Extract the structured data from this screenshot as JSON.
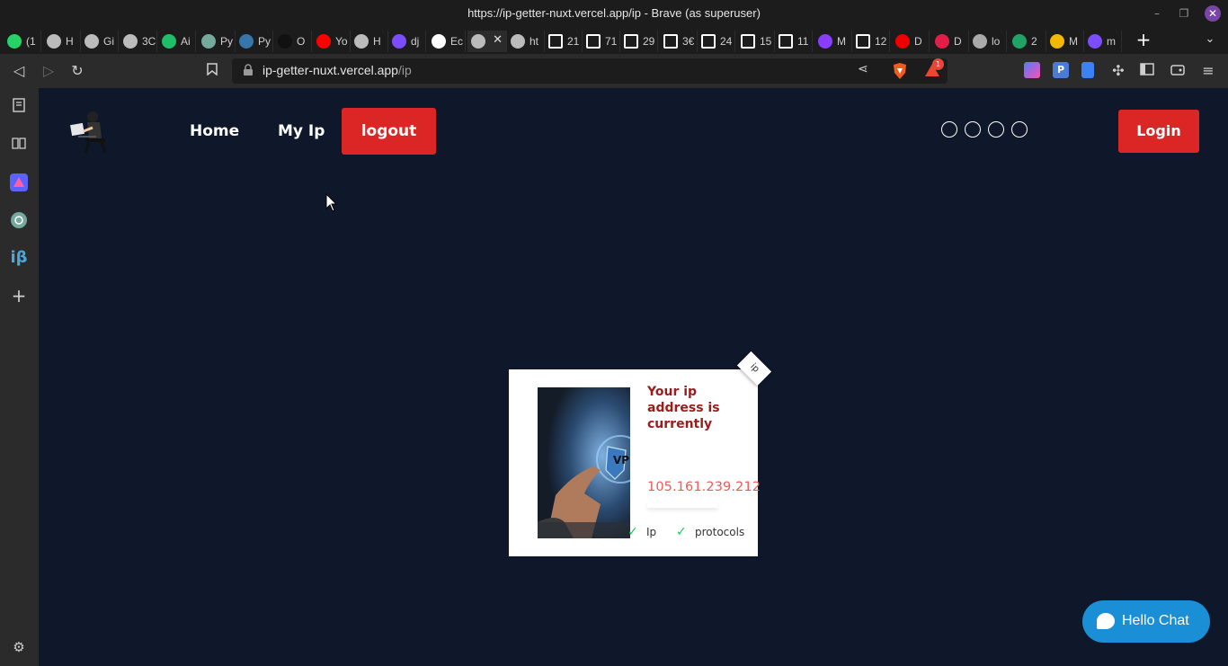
{
  "window": {
    "title": "https://ip-getter-nuxt.vercel.app/ip - Brave (as superuser)",
    "minimize_icon": "minimize-icon",
    "restore_icon": "restore-icon",
    "close_icon": "close-icon"
  },
  "tabs": [
    {
      "label": "(1",
      "icon": "whatsapp-icon",
      "color": "#25d366"
    },
    {
      "label": "H",
      "icon": "globe-icon",
      "color": "#bbbbbb"
    },
    {
      "label": "Gi",
      "icon": "globe-icon",
      "color": "#bbbbbb"
    },
    {
      "label": "3C",
      "icon": "globe-icon",
      "color": "#bbbbbb"
    },
    {
      "label": "Ai",
      "icon": "activity-icon",
      "color": "#1fbf6a"
    },
    {
      "label": "Py",
      "icon": "openai-icon",
      "color": "#74aa9c"
    },
    {
      "label": "Py",
      "icon": "python-icon",
      "color": "#3776ab"
    },
    {
      "label": "O",
      "icon": "openai-dark-icon",
      "color": "#111111"
    },
    {
      "label": "Yo",
      "icon": "youtube-icon",
      "color": "#ff0000"
    },
    {
      "label": "H",
      "icon": "globe-icon",
      "color": "#bbbbbb"
    },
    {
      "label": "dj",
      "icon": "app-icon",
      "color": "#7c4dff"
    },
    {
      "label": "Ec",
      "icon": "github-icon",
      "color": "#ffffff"
    },
    {
      "label": "",
      "icon": "globe-icon",
      "color": "#bbbbbb",
      "active": true
    },
    {
      "label": "ht",
      "icon": "globe-icon",
      "color": "#bbbbbb"
    },
    {
      "label": "21",
      "icon": "f-icon",
      "color": "#ffffff"
    },
    {
      "label": "71",
      "icon": "f-icon",
      "color": "#ffffff"
    },
    {
      "label": "29",
      "icon": "f-icon",
      "color": "#ffffff"
    },
    {
      "label": "3€",
      "icon": "f-icon",
      "color": "#ffffff"
    },
    {
      "label": "24",
      "icon": "f-icon",
      "color": "#ffffff"
    },
    {
      "label": "15",
      "icon": "f-icon",
      "color": "#ffffff"
    },
    {
      "label": "11",
      "icon": "f-icon",
      "color": "#ffffff"
    },
    {
      "label": "M",
      "icon": "app-purple-icon",
      "color": "#8b3dff"
    },
    {
      "label": "12",
      "icon": "f-icon",
      "color": "#ffffff"
    },
    {
      "label": "D",
      "icon": "redhat-icon",
      "color": "#ee0000"
    },
    {
      "label": "D",
      "icon": "red-icon",
      "color": "#e11d48"
    },
    {
      "label": "lo",
      "icon": "triangle-icon",
      "color": "#aaaaaa"
    },
    {
      "label": "2",
      "icon": "px-icon",
      "color": "#21a366"
    },
    {
      "label": "M",
      "icon": "sun-icon",
      "color": "#f5b800"
    },
    {
      "label": "m",
      "icon": "app-icon",
      "color": "#7c4dff"
    }
  ],
  "toolbar": {
    "back_icon": "back-icon",
    "forward_icon": "forward-icon",
    "reload_icon": "reload-icon",
    "bookmark_icon": "bookmark-icon",
    "url_host": "ip-getter-nuxt.vercel.app",
    "url_path": "/ip",
    "rewards_badge": "1"
  },
  "page": {
    "nav": {
      "home": "Home",
      "my_ip": "My Ip",
      "logout": "logout",
      "login": "Login"
    },
    "card": {
      "heading": "Your ip address is currently",
      "ip": "105.161.239.212",
      "tag": "ip",
      "features": [
        "Ip",
        "protocols"
      ],
      "photo_text": "VP"
    },
    "chat": {
      "label": "Hello Chat"
    }
  },
  "colors": {
    "page_bg": "#0f172a",
    "accent_red": "#dc2626",
    "ip_text": "#ef5a5a",
    "heading_text": "#9b1c1c",
    "chat_blue": "#1a8fd6"
  }
}
